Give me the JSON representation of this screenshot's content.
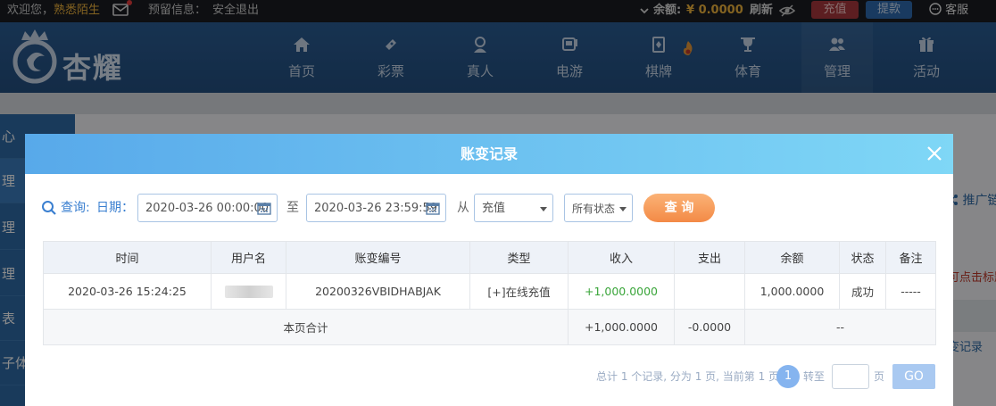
{
  "topbar": {
    "welcome_prefix": "欢迎您，",
    "username": "熟悉陌生",
    "notice_label": "预留信息：",
    "logout": "安全退出",
    "balance_label": "余额:",
    "balance_value": "¥ 0.0000",
    "refresh": "刷新",
    "deposit": "充值",
    "withdraw": "提款",
    "service": "客服"
  },
  "logo": {
    "text": "杏耀"
  },
  "nav": {
    "items": [
      {
        "label": "首页",
        "icon": "home-icon"
      },
      {
        "label": "彩票",
        "icon": "ticket-icon"
      },
      {
        "label": "真人",
        "icon": "dealer-icon"
      },
      {
        "label": "电游",
        "icon": "arcade-icon"
      },
      {
        "label": "棋牌",
        "icon": "cards-icon"
      },
      {
        "label": "体育",
        "icon": "trophy-icon"
      },
      {
        "label": "管理",
        "icon": "users-icon"
      },
      {
        "label": "活动",
        "icon": "gift-icon"
      }
    ]
  },
  "background": {
    "sidebar": [
      "心",
      "理",
      "理",
      "理",
      "表",
      "子体"
    ],
    "promo_link": "推广链",
    "hint_text": "可点击标题",
    "record_link": "变记录"
  },
  "modal": {
    "title": "账变记录",
    "query": {
      "label": "查询:",
      "date_label": "日期：",
      "start": "2020-03-26 00:00:00",
      "to": "至",
      "end": "2020-03-26 23:59:59",
      "from": "从",
      "type": "充值",
      "status": "所有状态",
      "button": "查 询"
    },
    "table": {
      "columns": [
        "时间",
        "用户名",
        "账变编号",
        "类型",
        "收入",
        "支出",
        "余额",
        "状态",
        "备注"
      ],
      "rows": [
        {
          "time": "2020-03-26 15:24:25",
          "username": "",
          "order_no": "20200326VBIDHABJAK",
          "type": "[+]在线充值",
          "income": "+1,000.0000",
          "expense": "",
          "balance": "1,000.0000",
          "status": "成功",
          "remark": "-----"
        }
      ],
      "summary": {
        "label": "本页合计",
        "income": "+1,000.0000",
        "expense": "-0.0000",
        "balance": "--"
      }
    },
    "pagination": {
      "summary": "总计 1 个记录, 分为 1 页, 当前第 1 页",
      "current": "1",
      "goto": "转至",
      "unit": "页",
      "go": "GO"
    }
  },
  "colors": {
    "topbar_bg": "#1b1d22",
    "nav_bg": "#2a5d94",
    "accent_gold": "#f0b43c",
    "modal_header_from": "#58a9ea",
    "modal_header_to": "#7fd7f6",
    "query_button": "#f38a46",
    "income_green": "#3aa53a"
  }
}
